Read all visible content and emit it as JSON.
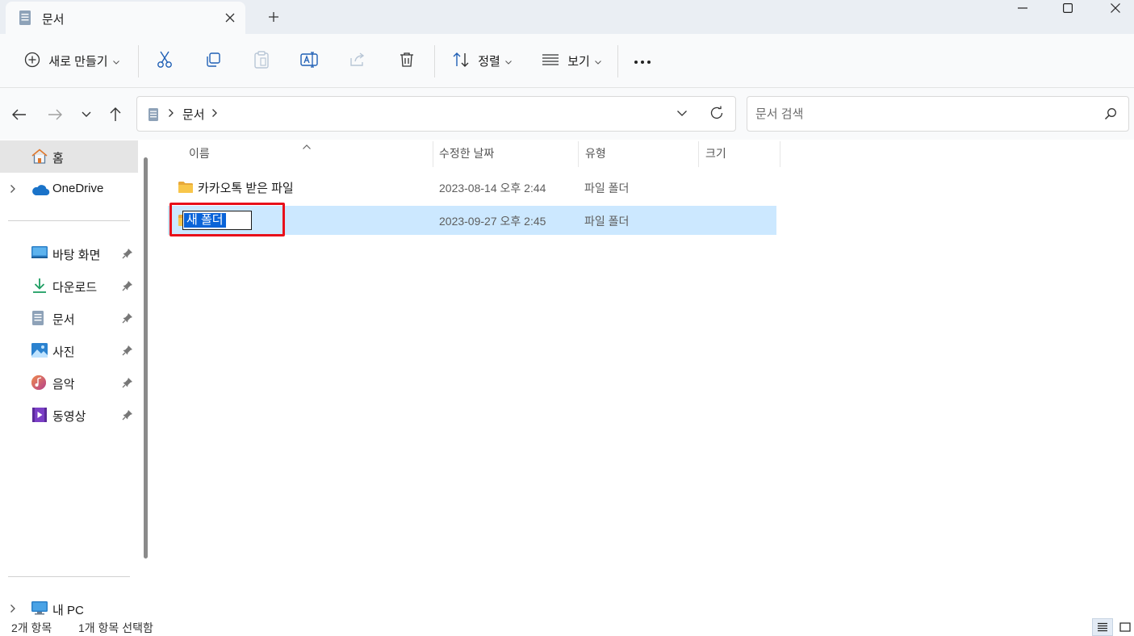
{
  "window": {
    "tab_title": "문서",
    "controls": [
      "minimize-icon",
      "maximize-icon",
      "close-icon"
    ]
  },
  "commandbar": {
    "new_label": "새로 만들기",
    "sort_label": "정렬",
    "view_label": "보기",
    "icons": [
      "cut-icon",
      "copy-icon",
      "paste-icon",
      "rename-icon",
      "share-icon",
      "delete-icon",
      "more-icon"
    ]
  },
  "address": {
    "breadcrumb": [
      "문서"
    ],
    "search_placeholder": "문서 검색"
  },
  "navpane": {
    "home": "홈",
    "onedrive": "OneDrive",
    "quick_access": [
      {
        "label": "바탕 화면",
        "icon": "desktop-icon"
      },
      {
        "label": "다운로드",
        "icon": "download-icon"
      },
      {
        "label": "문서",
        "icon": "documents-icon"
      },
      {
        "label": "사진",
        "icon": "pictures-icon"
      },
      {
        "label": "음악",
        "icon": "music-icon"
      },
      {
        "label": "동영상",
        "icon": "videos-icon"
      }
    ],
    "this_pc": "내 PC"
  },
  "filelist": {
    "columns": {
      "name": "이름",
      "modified": "수정한 날짜",
      "type": "유형",
      "size": "크기"
    },
    "rows": [
      {
        "name": "카카오톡 받은 파일",
        "modified": "2023-08-14 오후 2:44",
        "type": "파일 폴더",
        "size": "",
        "selected": false
      },
      {
        "name": "새 폴더",
        "modified": "2023-09-27 오후 2:45",
        "type": "파일 폴더",
        "size": "",
        "selected": true
      }
    ],
    "rename_value": "새 폴더"
  },
  "status": {
    "count": "2개 항목",
    "selection": "1개 항목 선택함"
  },
  "colors": {
    "selection": "#cce8ff",
    "highlight_box": "#e8101a",
    "text_selection": "#0a64d8",
    "folder": "#f8c64a"
  }
}
